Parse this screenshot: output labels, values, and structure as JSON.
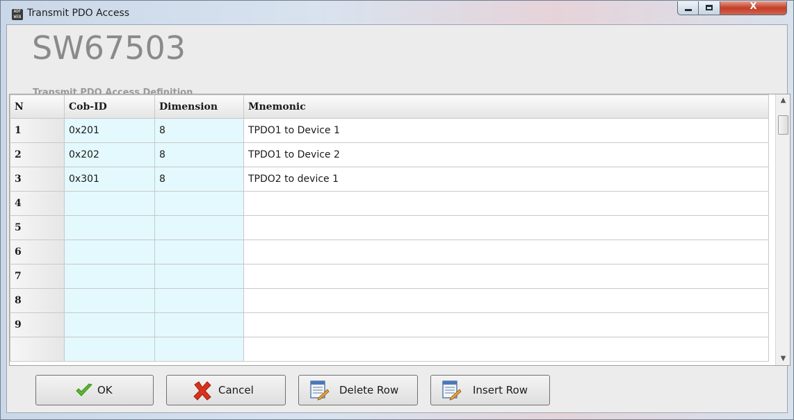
{
  "window": {
    "title": "Transmit PDO Access",
    "app_icon_text": "ADF WEB",
    "minimize_label": "",
    "maximize_label": "",
    "close_label": "X"
  },
  "header": {
    "product": "SW67503",
    "subtitle": "Transmit PDO Access Definition"
  },
  "table": {
    "columns": [
      "N",
      "Cob-ID",
      "Dimension",
      "Mnemonic"
    ],
    "rows": [
      {
        "n": "1",
        "cob_id": "0x201",
        "dimension": "8",
        "mnemonic": "TPDO1 to Device 1"
      },
      {
        "n": "2",
        "cob_id": "0x202",
        "dimension": "8",
        "mnemonic": "TPDO1 to Device 2"
      },
      {
        "n": "3",
        "cob_id": "0x301",
        "dimension": "8",
        "mnemonic": "TPDO2 to device 1"
      },
      {
        "n": "4",
        "cob_id": "",
        "dimension": "",
        "mnemonic": ""
      },
      {
        "n": "5",
        "cob_id": "",
        "dimension": "",
        "mnemonic": ""
      },
      {
        "n": "6",
        "cob_id": "",
        "dimension": "",
        "mnemonic": ""
      },
      {
        "n": "7",
        "cob_id": "",
        "dimension": "",
        "mnemonic": ""
      },
      {
        "n": "8",
        "cob_id": "",
        "dimension": "",
        "mnemonic": ""
      },
      {
        "n": "9",
        "cob_id": "",
        "dimension": "",
        "mnemonic": ""
      }
    ]
  },
  "buttons": {
    "ok": "OK",
    "cancel": "Cancel",
    "delete_row": "Delete Row",
    "insert_row": "Insert Row"
  },
  "colors": {
    "editable_cell": "#e3f9fd",
    "ok_check": "#5cb82e",
    "cancel_x": "#d8321c",
    "close_button": "#c33d26"
  },
  "icons": [
    "app-icon",
    "minimize-icon",
    "maximize-icon",
    "close-icon",
    "checkmark-icon",
    "red-x-icon",
    "delete-row-icon",
    "insert-row-icon",
    "scroll-up-icon",
    "scroll-down-icon"
  ]
}
